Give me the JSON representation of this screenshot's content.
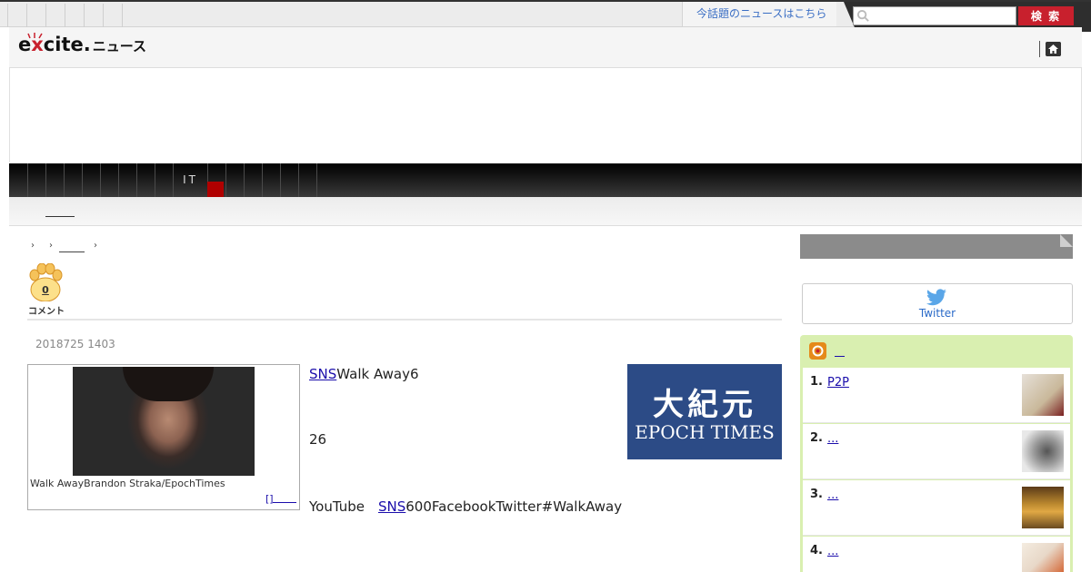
{
  "topbar": {
    "trend_link": "今話題のニュースはこちら"
  },
  "search": {
    "placeholder": "",
    "button_label": "検 索"
  },
  "logo": {
    "brand_prefix": "e",
    "brand_x": "x",
    "brand_suffix": "cite.",
    "section": "ニュース"
  },
  "nav": {
    "items": [
      "IT"
    ]
  },
  "article": {
    "date": "2018725 1403",
    "comments": {
      "count": "0",
      "label": "コメント"
    },
    "photo_caption": "Walk AwayBrandon Straka/EpochTimes",
    "photo_more": "[]",
    "paragraphs": [
      {
        "link": "SNS",
        "text": "Walk Away6"
      },
      {
        "link": "",
        "text": "26"
      },
      {
        "prefix": "YouTube　",
        "link": "SNS",
        "text": "600FacebookTwitter#WalkAway"
      }
    ]
  },
  "epoch_logo": {
    "chinese": "大紀元",
    "english": "EPOCH TIMES"
  },
  "sidebar": {
    "twitter_label": "Twitter",
    "ranking_title": "",
    "ranking": [
      {
        "num": "1.",
        "title": "P2P",
        "thumb_color": "#c9b89a"
      },
      {
        "num": "2.",
        "title": "...",
        "thumb_color": "#9a9a9a"
      },
      {
        "num": "3.",
        "title": "...",
        "thumb_color": "#b8862e"
      },
      {
        "num": "4.",
        "title": "...",
        "thumb_color": "#e8d8c8"
      }
    ]
  },
  "colors": {
    "accent_red": "#c8202d",
    "link_blue": "#1a0dab",
    "ranking_green": "#d9efb0",
    "epoch_blue": "#2c4b86"
  }
}
